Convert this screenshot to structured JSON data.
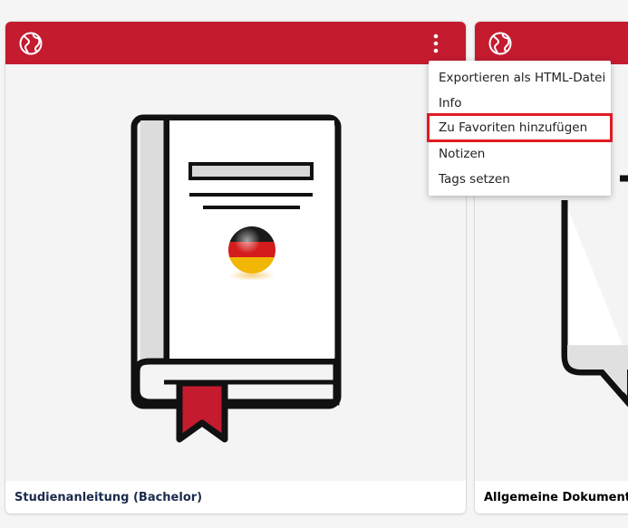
{
  "cards": [
    {
      "title": "Studienanleitung (Bachelor)"
    },
    {
      "title": "Allgemeine Dokumente"
    }
  ],
  "context_menu": {
    "items": [
      {
        "label": "Exportieren als HTML-Datei",
        "highlighted": false
      },
      {
        "label": "Info",
        "highlighted": false
      },
      {
        "label": "Zu Favoriten hinzufügen",
        "highlighted": true
      },
      {
        "label": "Notizen",
        "highlighted": false
      },
      {
        "label": "Tags setzen",
        "highlighted": false
      }
    ]
  },
  "colors": {
    "header": "#c41b2f",
    "highlight_border": "#e11b22",
    "title_text": "#1b2b4d"
  },
  "icons": [
    "globe-icon",
    "more-vertical-icon",
    "book-icon",
    "german-flag-ball-icon",
    "speech-bubble-icon"
  ]
}
